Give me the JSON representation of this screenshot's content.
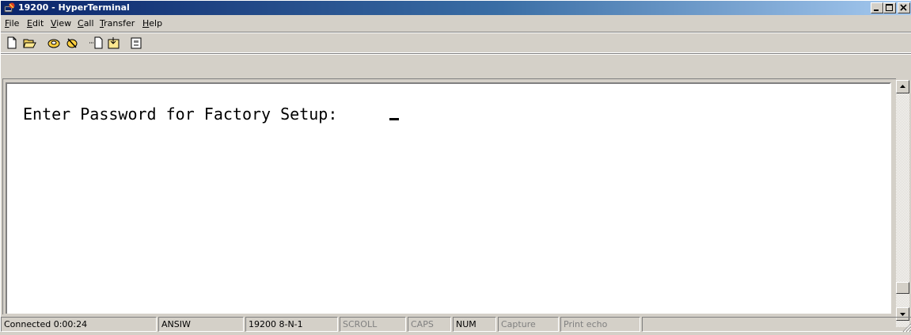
{
  "window": {
    "title": "19200 - HyperTerminal",
    "app_icon": "hyperterminal-icon",
    "controls": [
      "minimize-icon",
      "maximize-icon",
      "close-icon"
    ]
  },
  "menu": {
    "items": [
      {
        "label": "File",
        "accel": "F"
      },
      {
        "label": "Edit",
        "accel": "E"
      },
      {
        "label": "View",
        "accel": "V"
      },
      {
        "label": "Call",
        "accel": "C"
      },
      {
        "label": "Transfer",
        "accel": "T"
      },
      {
        "label": "Help",
        "accel": "H"
      }
    ]
  },
  "toolbar": {
    "buttons": [
      "new-connection-icon",
      "open-icon",
      "connect-icon",
      "disconnect-icon",
      "send-icon",
      "receive-icon",
      "properties-icon"
    ]
  },
  "terminal": {
    "prompt": "Enter Password for Factory Setup: "
  },
  "status": {
    "connection": "Connected 0:00:24",
    "emulation": "ANSIW",
    "port_settings": "19200 8-N-1",
    "scroll": "SCROLL",
    "caps": "CAPS",
    "num": "NUM",
    "capture": "Capture",
    "print_echo": "Print echo"
  },
  "colors": {
    "title_gradient_start": "#0a246a",
    "title_gradient_end": "#a6caf0",
    "face": "#d4d0c8",
    "disabled_text": "#808080"
  }
}
